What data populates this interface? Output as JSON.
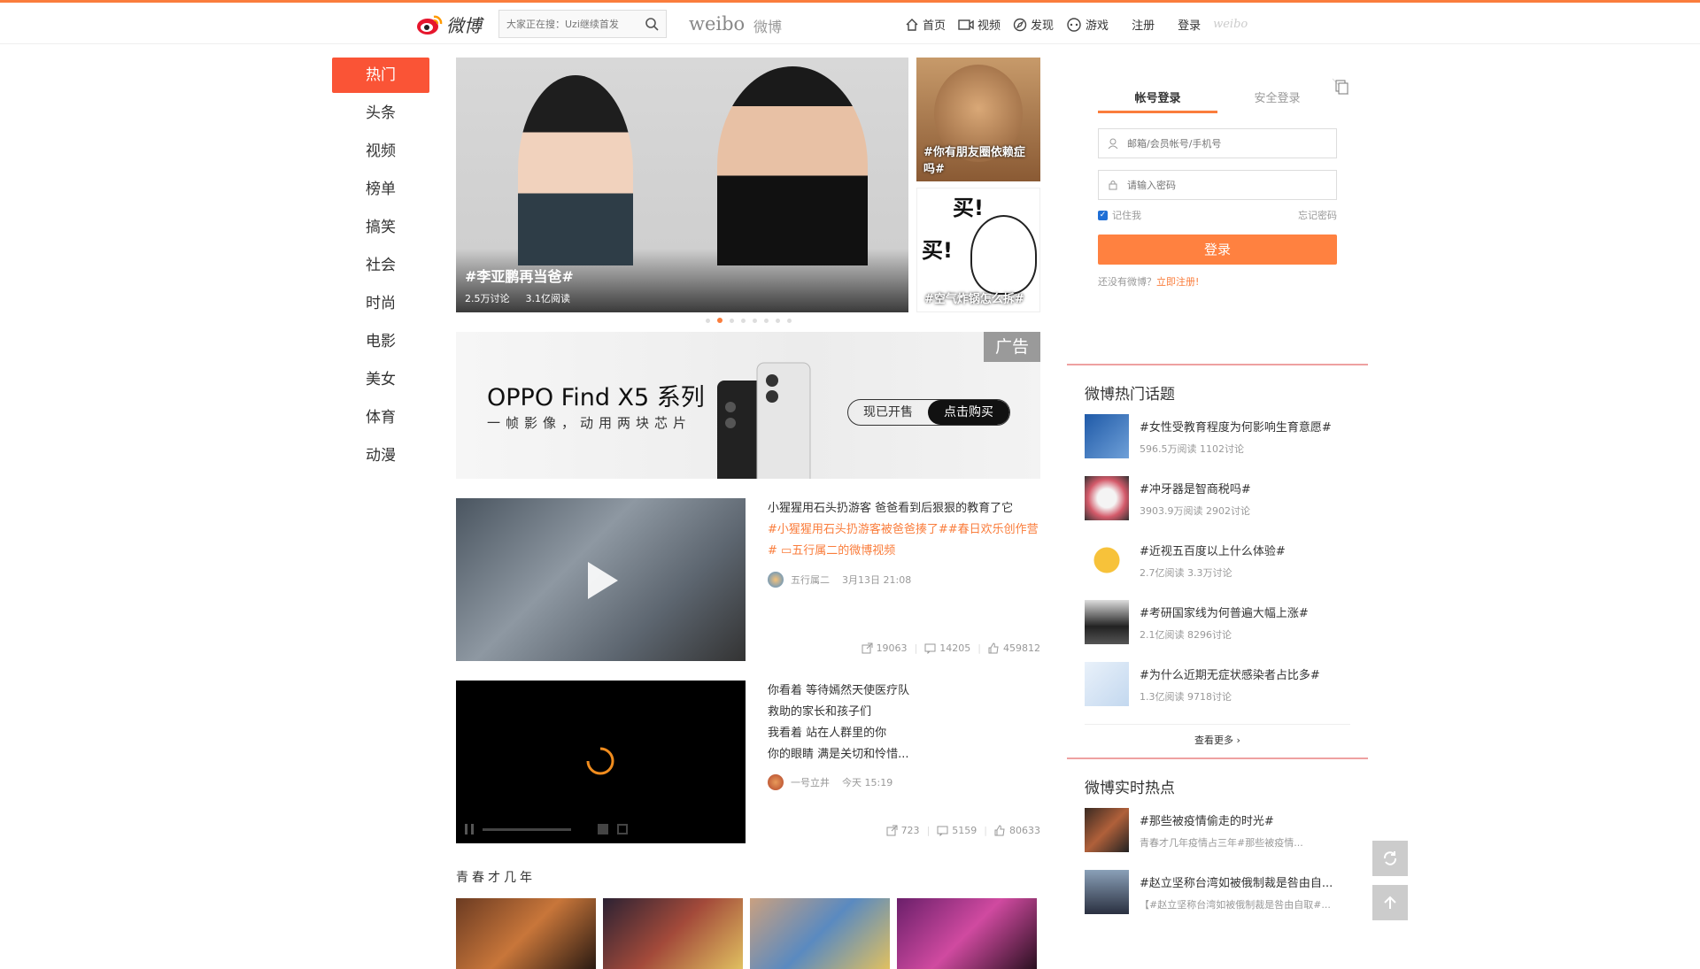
{
  "header": {
    "logo_text": "微博",
    "search_placeholder": "大家正在搜：Uzi继续首发",
    "brand_en": "weibo",
    "brand_cn": "微博",
    "nav": [
      {
        "label": "首页",
        "icon": "home-icon"
      },
      {
        "label": "视频",
        "icon": "video-icon"
      },
      {
        "label": "发现",
        "icon": "discover-icon"
      },
      {
        "label": "游戏",
        "icon": "game-icon"
      }
    ],
    "register": "注册",
    "login": "登录",
    "weibo_faint": "weibo"
  },
  "leftnav": [
    "热门",
    "头条",
    "视频",
    "榜单",
    "搞笑",
    "社会",
    "时尚",
    "电影",
    "美女",
    "体育",
    "动漫"
  ],
  "hero": {
    "caption": "#李亚鹏再当爸#",
    "discuss": "2.5万讨论",
    "read": "3.1亿阅读",
    "side1_caption": "#你有朋友圈依赖症吗#",
    "side2_caption": "#空气炸锅怎么拆#",
    "side2_text": "买!",
    "side2_text2": "买!"
  },
  "ad": {
    "tag": "广告",
    "title": "OPPO Find X5 系列",
    "subtitle": "一帧影像，动用两块芯片",
    "btn_left": "现已开售",
    "btn_right": "点击购买"
  },
  "feed": [
    {
      "text_plain": "小猩猩用石头扔游客 爸爸看到后狠狠的教育了它",
      "text_tags": "#小猩猩用石头扔游客被爸爸揍了##春日欢乐创作营# ▭五行属二的微博视频",
      "author": "五行属二",
      "time": "3月13日 21:08",
      "forward": "19063",
      "comment": "14205",
      "like": "459812"
    },
    {
      "lines": [
        "你看着 等待嫣然天使医疗队",
        "救助的家长和孩子们",
        "我看着 站在人群里的你",
        "你的眼睛 满是关切和怜惜..."
      ],
      "author": "一号立井",
      "time": "今天 15:19",
      "forward": "723",
      "comment": "5159",
      "like": "80633"
    }
  ],
  "section_title": "青春才几年",
  "login": {
    "tab1": "帐号登录",
    "tab2": "安全登录",
    "user_placeholder": "邮箱/会员帐号/手机号",
    "pass_placeholder": "请输入密码",
    "remember": "记住我",
    "forgot": "忘记密码",
    "button": "登录",
    "no_account": "还没有微博？",
    "register_now": "立即注册!"
  },
  "hot_topics": {
    "title": "微博热门话题",
    "items": [
      {
        "title": "#女性受教育程度为何影响生育意愿#",
        "meta": "596.5万阅读 1102讨论"
      },
      {
        "title": "#冲牙器是智商税吗#",
        "meta": "3903.9万阅读 2902讨论"
      },
      {
        "title": "#近视五百度以上什么体验#",
        "meta": "2.7亿阅读 3.3万讨论"
      },
      {
        "title": "#考研国家线为何普遍大幅上涨#",
        "meta": "2.1亿阅读 8296讨论"
      },
      {
        "title": "#为什么近期无症状感染者占比多#",
        "meta": "1.3亿阅读 9718讨论"
      }
    ],
    "more": "查看更多 ›"
  },
  "realtime": {
    "title": "微博实时热点",
    "items": [
      {
        "title": "#那些被疫情偷走的时光#",
        "meta": "青春才几年疫情占三年#那些被疫情..."
      },
      {
        "title": "#赵立坚称台湾如被俄制裁是咎由自...",
        "meta": "【#赵立坚称台湾如被俄制裁是咎由自取#..."
      }
    ]
  },
  "colors": {
    "accent": "#fa7d3c",
    "active_nav": "#fa5436",
    "login_button": "#ff8140"
  }
}
